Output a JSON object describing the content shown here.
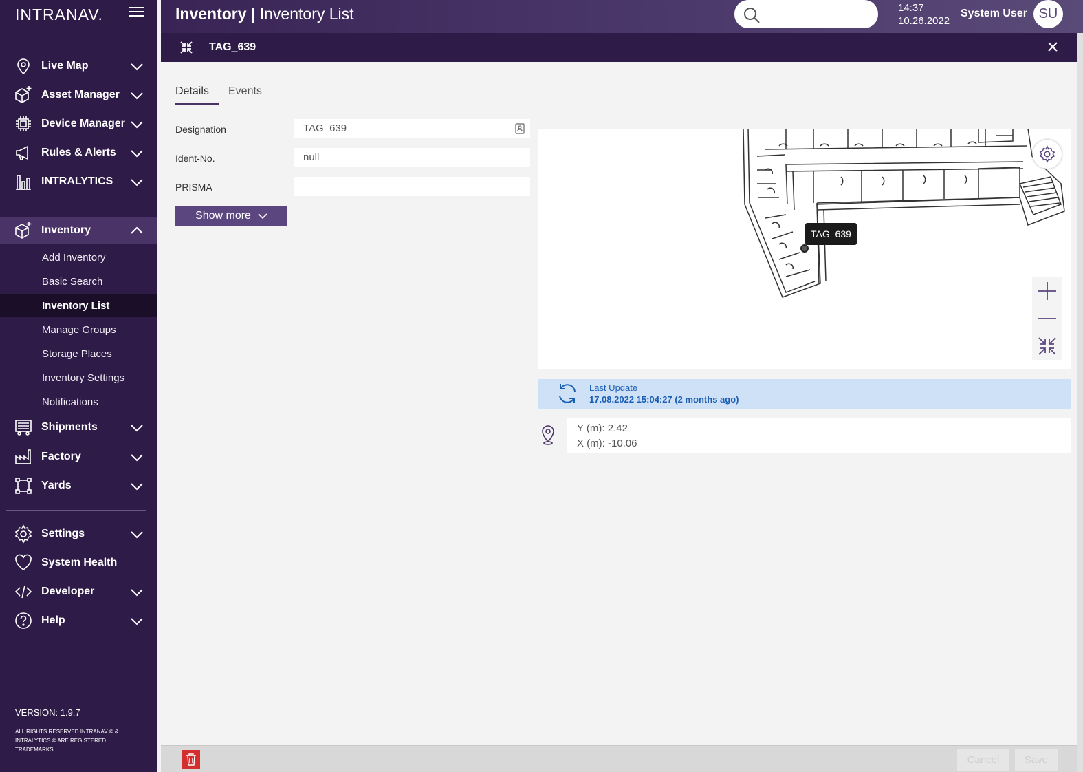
{
  "brand": "INTRANAV.",
  "sidebar": {
    "items": [
      {
        "label": "Live Map",
        "icon": "map-pin-icon"
      },
      {
        "label": "Asset Manager",
        "icon": "cube-plus-icon"
      },
      {
        "label": "Device Manager",
        "icon": "chip-icon"
      },
      {
        "label": "Rules & Alerts",
        "icon": "megaphone-icon"
      },
      {
        "label": "INTRALYTICS",
        "icon": "bar-chart-icon"
      },
      {
        "label": "Inventory",
        "icon": "cube-plus-icon"
      },
      {
        "label": "Shipments",
        "icon": "truck-icon"
      },
      {
        "label": "Factory",
        "icon": "factory-icon"
      },
      {
        "label": "Yards",
        "icon": "square-nodes-icon"
      },
      {
        "label": "Settings",
        "icon": "gear-icon"
      },
      {
        "label": "System Health",
        "icon": "heart-icon"
      },
      {
        "label": "Developer",
        "icon": "code-icon"
      },
      {
        "label": "Help",
        "icon": "help-icon"
      }
    ],
    "inventory_sub": [
      "Add Inventory",
      "Basic Search",
      "Inventory List",
      "Manage Groups",
      "Storage Places",
      "Inventory Settings",
      "Notifications"
    ],
    "version": "VERSION:  1.9.7",
    "copyright": "ALL RIGHTS RESERVED INTRANAV © & INTRALYTICS © ARE REGISTERED TRADEMARKS."
  },
  "header": {
    "title_bold": "Inventory |",
    "title_rest": " Inventory List",
    "search_placeholder": "",
    "time": "14:37",
    "date": "10.26.2022",
    "user": "System User",
    "avatar": "SU"
  },
  "detail": {
    "tag": "TAG_639",
    "tabs": [
      "Details",
      "Events"
    ],
    "fields": [
      {
        "label": "Designation",
        "value": "TAG_639"
      },
      {
        "label": "Ident-No.",
        "value": "null"
      },
      {
        "label": "PRISMA",
        "value": ""
      }
    ],
    "show_more": "Show more",
    "map_tooltip": "TAG_639",
    "last_update_label": "Last Update",
    "last_update_value": "17.08.2022 15:04:27 (2 months ago)",
    "coord_y": "Y (m): 2.42",
    "coord_x": "X (m): -10.06"
  },
  "footer": {
    "cancel": "Cancel",
    "save": "Save"
  },
  "colors": {
    "sidebar": "#2e1b47",
    "accent": "#5c4680",
    "delete": "#d32f2f",
    "info_bg": "#cfe1f7",
    "info_text": "#1a5eb3"
  }
}
